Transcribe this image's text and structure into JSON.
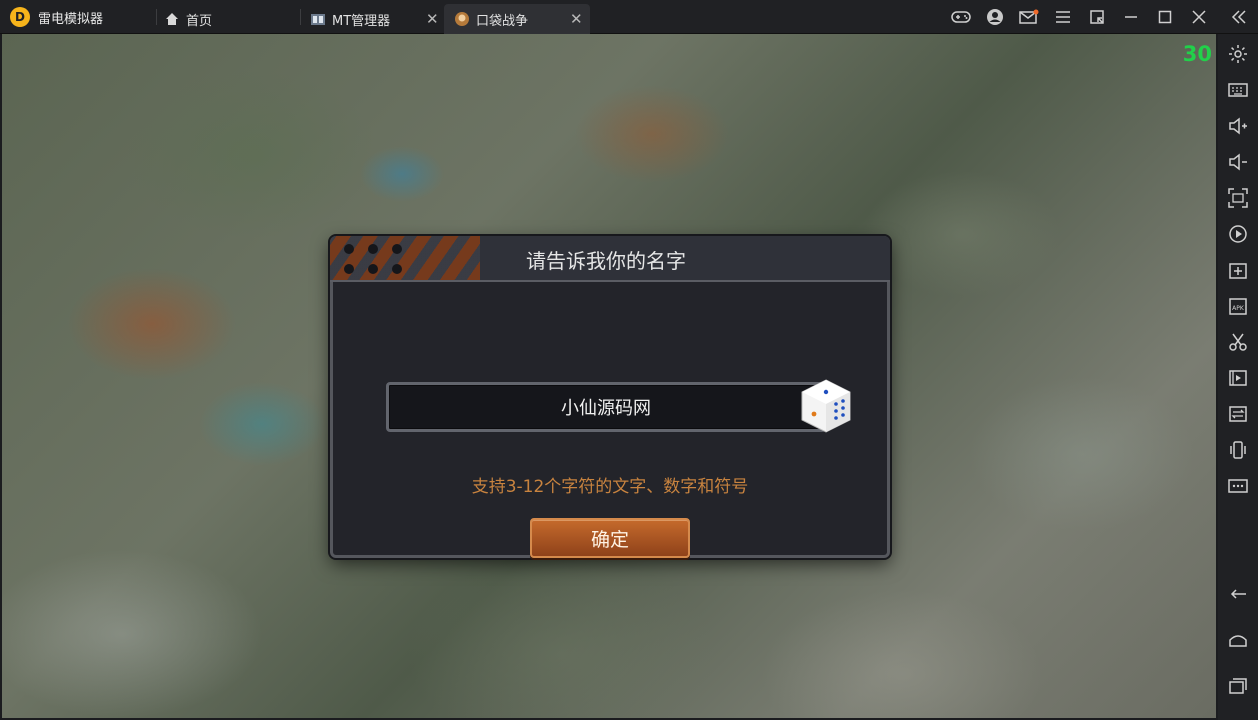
{
  "titlebar": {
    "app_name": "雷电模拟器",
    "tabs": [
      {
        "label": "首页",
        "icon": "home-icon",
        "active": false
      },
      {
        "label": "MT管理器",
        "icon": "mt-app-icon",
        "active": false
      },
      {
        "label": "口袋战争",
        "icon": "game-app-icon",
        "active": true
      }
    ],
    "controls": [
      "gamepad-icon",
      "account-icon",
      "mail-icon",
      "menu-icon",
      "shrink-icon",
      "minimize-icon",
      "maximize-icon",
      "close-icon",
      "collapse-sidebar-icon"
    ]
  },
  "game": {
    "fps": "30",
    "dialog": {
      "title": "请告诉我你的名字",
      "name_value": "小仙源码网",
      "hint": "支持3-12个字符的文字、数字和符号",
      "confirm_label": "确定"
    }
  },
  "sidebar": {
    "items": [
      "settings-icon",
      "keyboard-icon",
      "volume-up-icon",
      "volume-down-icon",
      "fullscreen-icon",
      "record-icon",
      "add-window-icon",
      "install-apk-icon",
      "scissors-icon",
      "video-icon",
      "sync-icon",
      "shake-icon",
      "more-icon"
    ],
    "bottom_items": [
      "back-icon",
      "home-nav-icon",
      "recent-apps-icon"
    ]
  },
  "colors": {
    "accent_orange": "#c56a2c",
    "hint_text": "#c8833f",
    "fps_green": "#21d14a"
  }
}
